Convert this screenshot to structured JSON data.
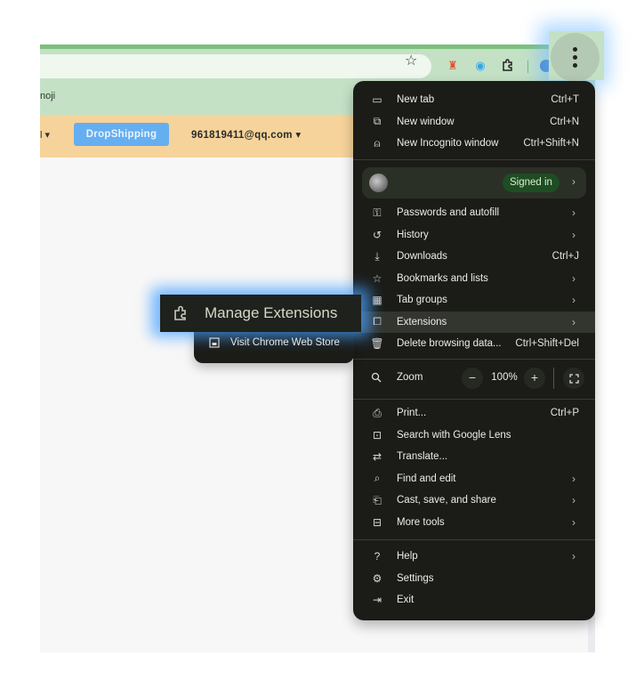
{
  "browser": {
    "bookmark_bar_partial_text": "noji",
    "toolbar_icons": [
      "bookmark-star-icon",
      "extension-red-figure-icon",
      "extension-blue-circle-icon",
      "extensions-puzzle-icon",
      "profile-avatar-icon",
      "more-options-kebab-icon"
    ]
  },
  "page": {
    "nav_partial_caret": "l ▾",
    "dropshipping_button": "DropShipping",
    "account_email": "961819411@qq.com ▾",
    "colors": {
      "toolbar": "#c4e1c6",
      "topnav": "#f6d39a",
      "dropshipping_button": "#65aef0"
    }
  },
  "menu": {
    "group1": [
      {
        "icon": "new-tab-icon",
        "label": "New tab",
        "shortcut": "Ctrl+T"
      },
      {
        "icon": "new-window-icon",
        "label": "New window",
        "shortcut": "Ctrl+N"
      },
      {
        "icon": "incognito-icon",
        "label": "New Incognito window",
        "shortcut": "Ctrl+Shift+N"
      }
    ],
    "profile": {
      "status": "Signed in"
    },
    "group2": [
      {
        "icon": "key-icon",
        "label": "Passwords and autofill",
        "shortcut": "",
        "submenu": true
      },
      {
        "icon": "history-icon",
        "label": "History",
        "shortcut": "",
        "submenu": true
      },
      {
        "icon": "download-icon",
        "label": "Downloads",
        "shortcut": "Ctrl+J",
        "submenu": false
      },
      {
        "icon": "star-icon",
        "label": "Bookmarks and lists",
        "shortcut": "",
        "submenu": true
      },
      {
        "icon": "tab-groups-icon",
        "label": "Tab groups",
        "shortcut": "",
        "submenu": true
      },
      {
        "icon": "puzzle-icon",
        "label": "Extensions",
        "shortcut": "",
        "submenu": true,
        "active": true
      },
      {
        "icon": "trash-icon",
        "label": "Delete browsing data...",
        "shortcut": "Ctrl+Shift+Del",
        "submenu": false
      }
    ],
    "zoom": {
      "label": "Zoom",
      "minus": "−",
      "value": "100%",
      "plus": "+"
    },
    "group3": [
      {
        "icon": "print-icon",
        "label": "Print...",
        "shortcut": "Ctrl+P",
        "submenu": false
      },
      {
        "icon": "google-lens-icon",
        "label": "Search with Google Lens",
        "shortcut": "",
        "submenu": false
      },
      {
        "icon": "translate-icon",
        "label": "Translate...",
        "shortcut": "",
        "submenu": false
      },
      {
        "icon": "find-icon",
        "label": "Find and edit",
        "shortcut": "",
        "submenu": true
      },
      {
        "icon": "cast-icon",
        "label": "Cast, save, and share",
        "shortcut": "",
        "submenu": true
      },
      {
        "icon": "toolbox-icon",
        "label": "More tools",
        "shortcut": "",
        "submenu": true
      }
    ],
    "group4": [
      {
        "icon": "help-icon",
        "label": "Help",
        "shortcut": "",
        "submenu": true
      },
      {
        "icon": "settings-gear-icon",
        "label": "Settings",
        "shortcut": "",
        "submenu": false
      },
      {
        "icon": "exit-icon",
        "label": "Exit",
        "shortcut": "",
        "submenu": false
      }
    ]
  },
  "extensions_submenu": {
    "manage": "Manage Extensions",
    "visit_store": "Visit Chrome Web Store"
  }
}
